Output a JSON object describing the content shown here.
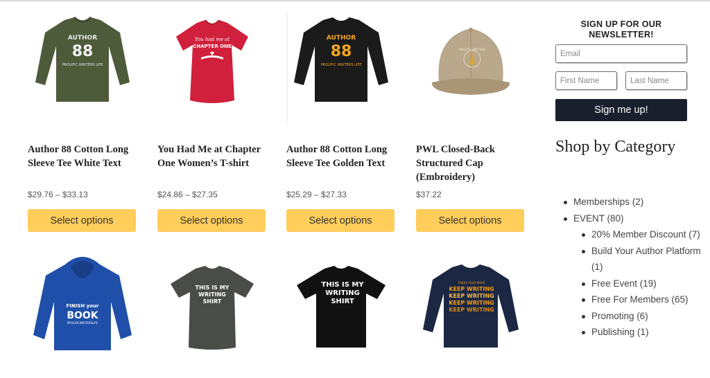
{
  "products": [
    {
      "title": "Author 88 Cotton Long Sleeve Tee White Text",
      "price": "$29.76 – $33.13",
      "button": "Select options",
      "image_icon": "green-long-sleeve-tee-icon",
      "shirt_text": [
        "AUTHOR",
        "88",
        "PROLIFIC WRITERS LIFE"
      ]
    },
    {
      "title": "You Had Me at Chapter One Women’s T-shirt",
      "price": "$24.86 – $27.35",
      "button": "Select options",
      "image_icon": "red-womens-tshirt-icon",
      "shirt_text": [
        "You had me at",
        "CHAPTER ONE"
      ]
    },
    {
      "title": "Author 88 Cotton Long Sleeve Tee Golden Text",
      "price": "$25.29 – $27.33",
      "button": "Select options",
      "image_icon": "black-long-sleeve-tee-icon",
      "shirt_text": [
        "AUTHOR",
        "88",
        "PROLIFIC WRITERS LIFE"
      ]
    },
    {
      "title": "PWL Closed-Back Structured Cap (Embroidery)",
      "price": "$37.22",
      "button": "Select options",
      "image_icon": "khaki-cap-icon",
      "shirt_text": [
        "PROLIFIC WRITERS"
      ]
    },
    {
      "image_icon": "blue-hoodie-icon",
      "shirt_text": [
        "FINISH your",
        "BOOK",
        "PROLIFICWRITERSLIFE"
      ]
    },
    {
      "image_icon": "gray-womens-tshirt-icon",
      "shirt_text": [
        "THIS IS MY",
        "WRITING",
        "SHIRT"
      ]
    },
    {
      "image_icon": "black-tshirt-icon",
      "shirt_text": [
        "THIS IS MY",
        "WRITING",
        "SHIRT"
      ]
    },
    {
      "image_icon": "navy-long-sleeve-tee-icon",
      "shirt_text": [
        "FINISH YOUR BOOK",
        "KEEP WRITING",
        "KEEP WRITING",
        "KEEP WRITING",
        "KEEP WRITING"
      ]
    }
  ],
  "newsletter": {
    "title": "SIGN UP FOR OUR NEWSLETTER!",
    "email_placeholder": "Email",
    "first_name_placeholder": "First Name",
    "last_name_placeholder": "Last Name",
    "submit_label": "Sign me up!"
  },
  "categories": {
    "heading": "Shop by Category",
    "items": [
      {
        "label": "Memberships (2)",
        "level": 0
      },
      {
        "label": "EVENT (80)",
        "level": 0
      },
      {
        "label": "20% Member Discount (7)",
        "level": 1
      },
      {
        "label": "Build Your Author Platform (1)",
        "level": 1
      },
      {
        "label": "Free Event (19)",
        "level": 1
      },
      {
        "label": "Free For Members (65)",
        "level": 1
      },
      {
        "label": "Promoting (6)",
        "level": 1
      },
      {
        "label": "Publishing (1)",
        "level": 1
      }
    ]
  },
  "colors": {
    "button_yellow": "#ffcd5a",
    "signup_dark": "#1a1f2e",
    "text_gold": "#f5a623",
    "text_orange": "#f39c12"
  }
}
